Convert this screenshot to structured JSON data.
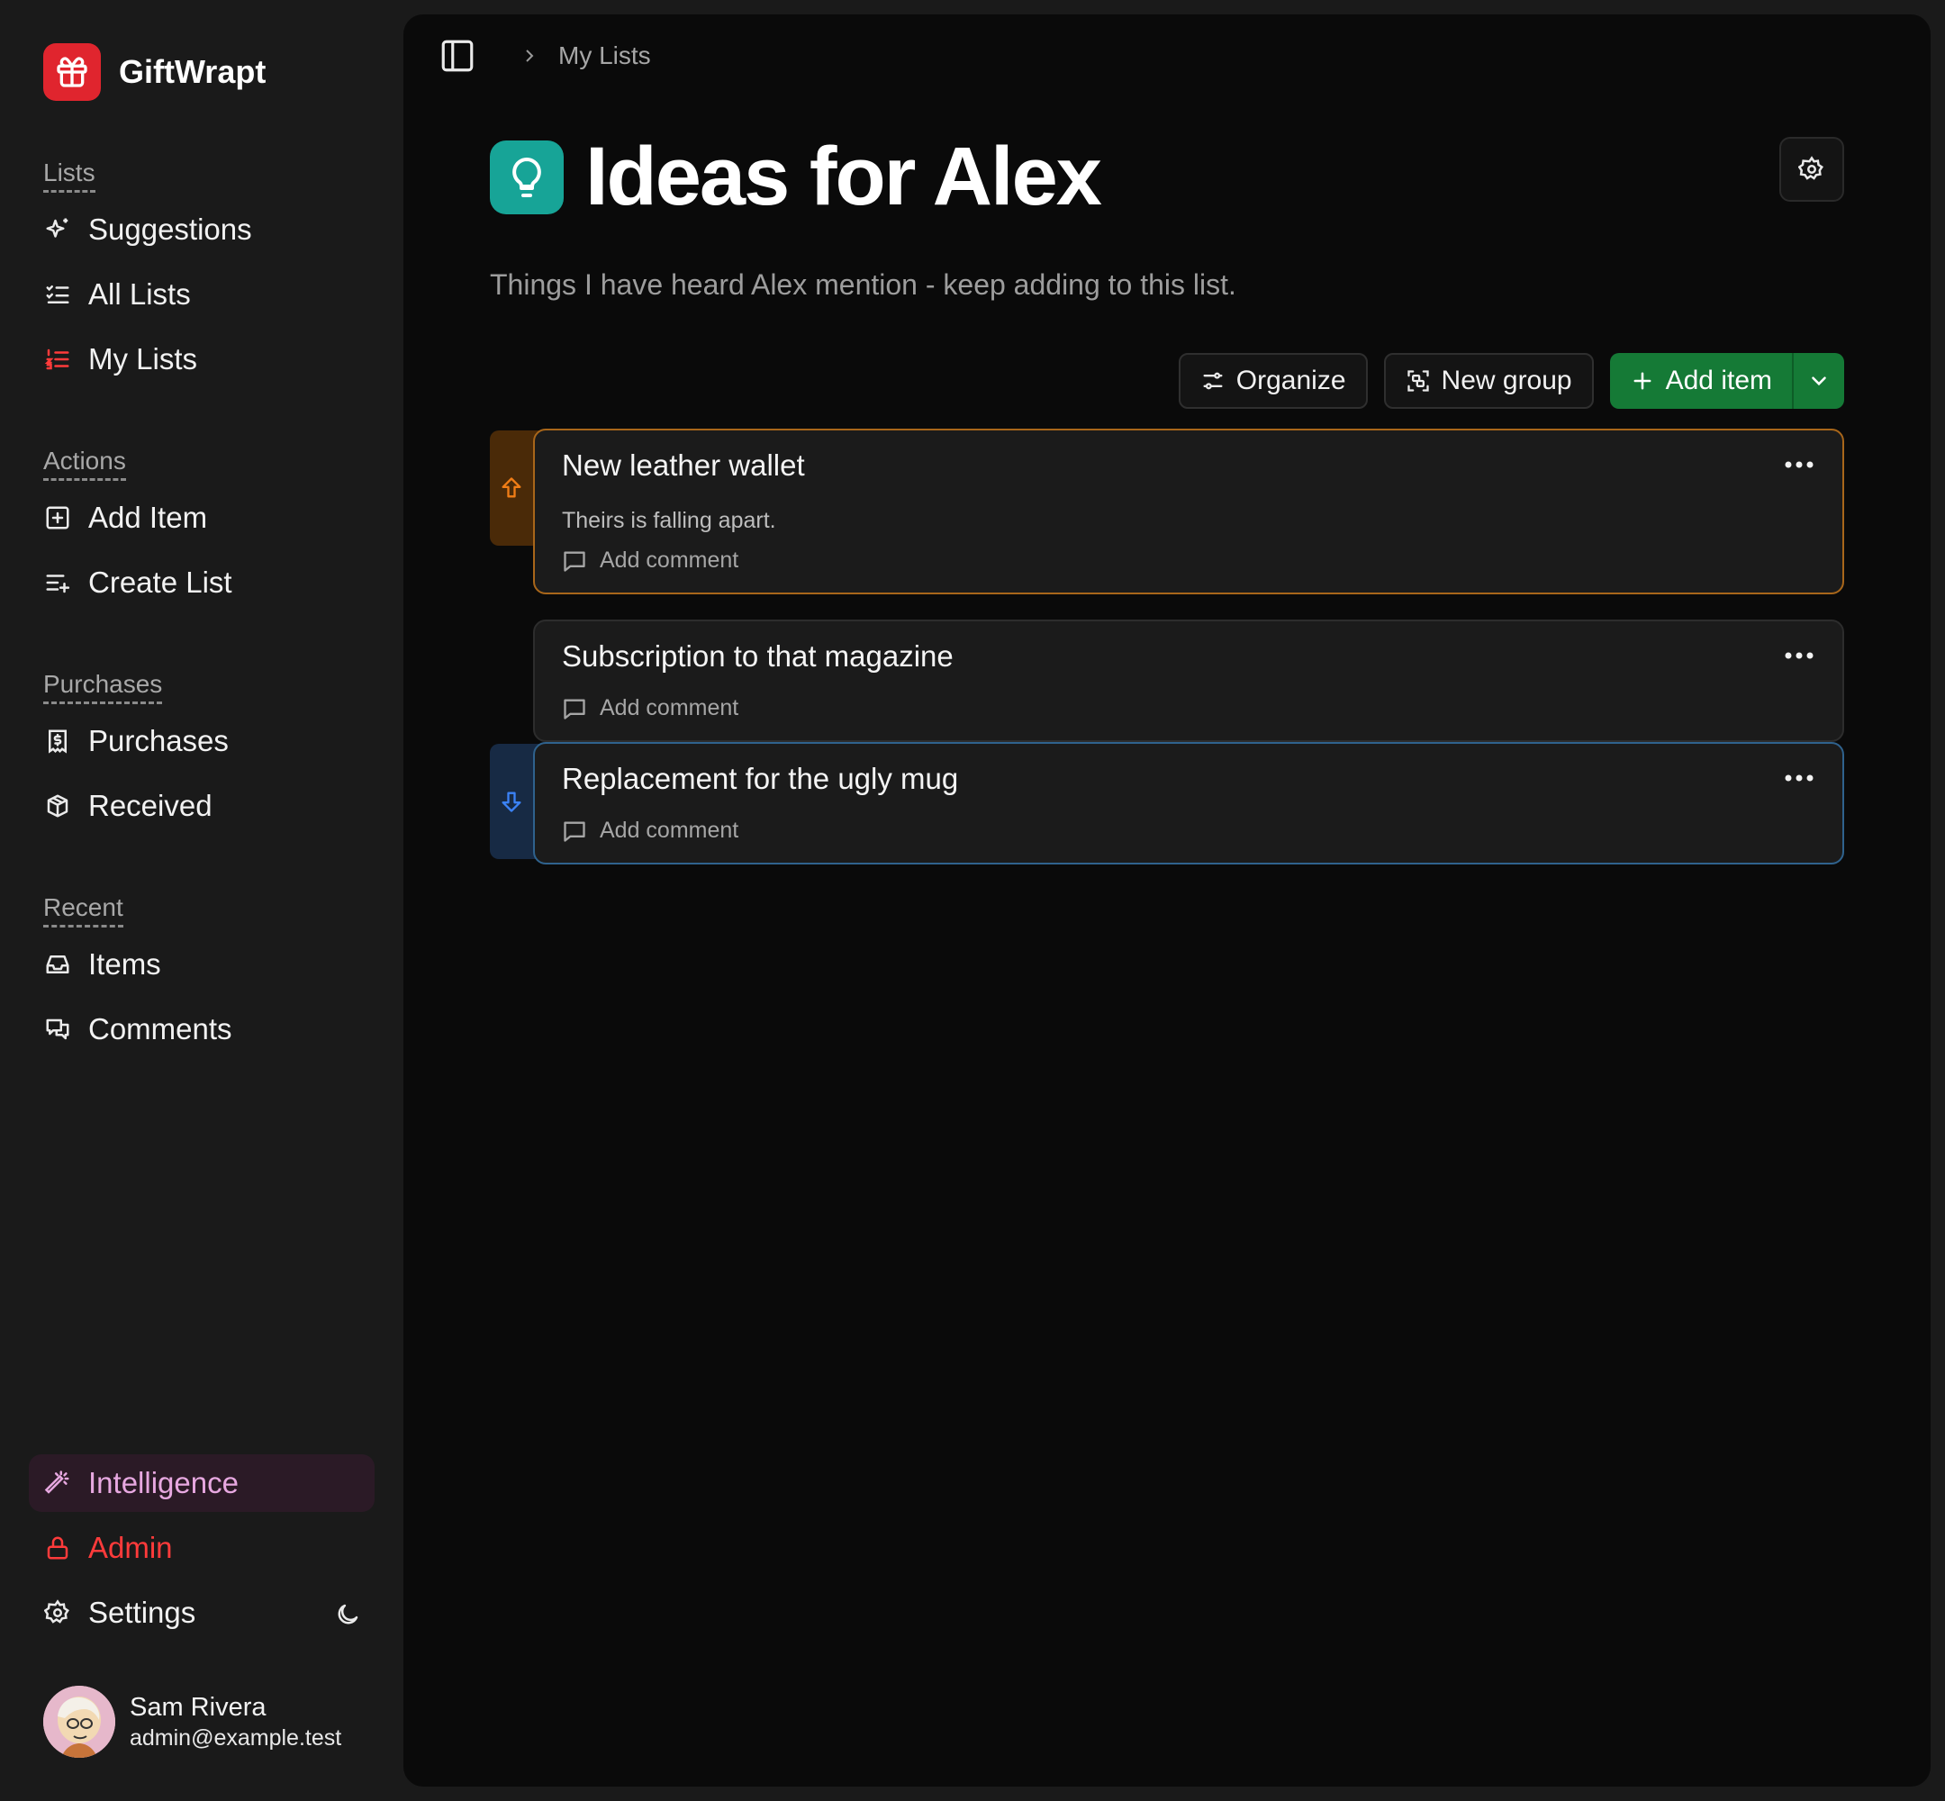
{
  "brand": {
    "name": "GiftWrapt",
    "accent": "#e0252e"
  },
  "sidebar": {
    "sections": [
      {
        "label": "Lists",
        "items": [
          {
            "label": "Suggestions",
            "icon": "sparkles-icon"
          },
          {
            "label": "All Lists",
            "icon": "list-checks-icon"
          },
          {
            "label": "My Lists",
            "icon": "list-ordered-icon",
            "color": "#ff3b3b"
          }
        ]
      },
      {
        "label": "Actions",
        "items": [
          {
            "label": "Add Item",
            "icon": "square-plus-icon"
          },
          {
            "label": "Create List",
            "icon": "list-plus-icon"
          }
        ]
      },
      {
        "label": "Purchases",
        "items": [
          {
            "label": "Purchases",
            "icon": "receipt-icon"
          },
          {
            "label": "Received",
            "icon": "package-icon"
          }
        ]
      },
      {
        "label": "Recent",
        "items": [
          {
            "label": "Items",
            "icon": "inbox-icon"
          },
          {
            "label": "Comments",
            "icon": "messages-icon"
          }
        ]
      }
    ],
    "footer": {
      "intelligence": "Intelligence",
      "admin": "Admin",
      "settings": "Settings"
    }
  },
  "user": {
    "name": "Sam Rivera",
    "email": "admin@example.test"
  },
  "breadcrumb": {
    "current": "My Lists"
  },
  "list": {
    "title": "Ideas for Alex",
    "description": "Things I have heard Alex mention - keep adding to this list.",
    "icon": "lightbulb-icon",
    "icon_color": "#17a497"
  },
  "toolbar": {
    "organize": "Organize",
    "new_group": "New group",
    "add_item": "Add item"
  },
  "items": [
    {
      "title": "New leather wallet",
      "note": "Theirs is falling apart.",
      "priority": "up",
      "comment": "Add comment"
    },
    {
      "title": "Subscription to that magazine",
      "note": "",
      "priority": "none",
      "comment": "Add comment"
    },
    {
      "title": "Replacement for the ugly mug",
      "note": "",
      "priority": "down",
      "comment": "Add comment"
    }
  ],
  "colors": {
    "priority_up": "#f07d16",
    "priority_down": "#3b82f6",
    "add_green": "#157a36"
  }
}
